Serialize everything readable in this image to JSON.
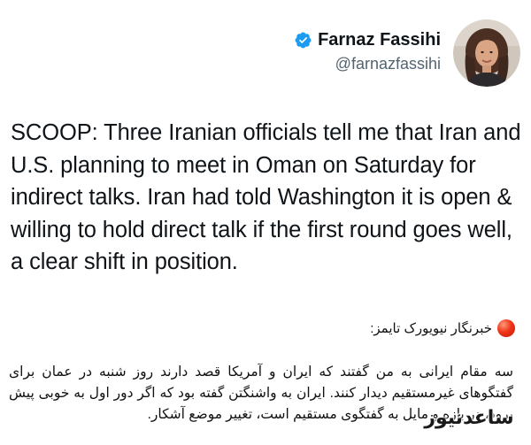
{
  "tweet": {
    "author": {
      "display_name": "Farnaz Fassihi",
      "handle": "@farnazfassihi",
      "verified": true,
      "avatar_icon": "profile-photo"
    },
    "text": "SCOOP: Three Iranian officials tell me that Iran and U.S. planning to meet in Oman on Saturday for indirect talks. Iran had told Washington it is open & willing to hold direct talk if the first round goes well, a clear shift in position."
  },
  "translation": {
    "source_label": "خبرنگار نیویورک تایمز:",
    "source_icon": "red-circle-icon",
    "text": "سه مقام ایرانی به من گفتند که ایران و آمریکا قصد دارند روز شنبه در عمان برای گفتگوهای غیرمستقیم دیدار کنند. ایران به واشنگتن گفته بود که اگر دور اول به خوبی پیش برود، در بازه و مایل به گفتگوی مستقیم است، تغییر موضع آشکار."
  },
  "watermark": {
    "text": "ساعدنیوز"
  },
  "colors": {
    "verified_blue": "#1d9bf0",
    "handle_gray": "#536471",
    "text_dark": "#0f1419"
  }
}
